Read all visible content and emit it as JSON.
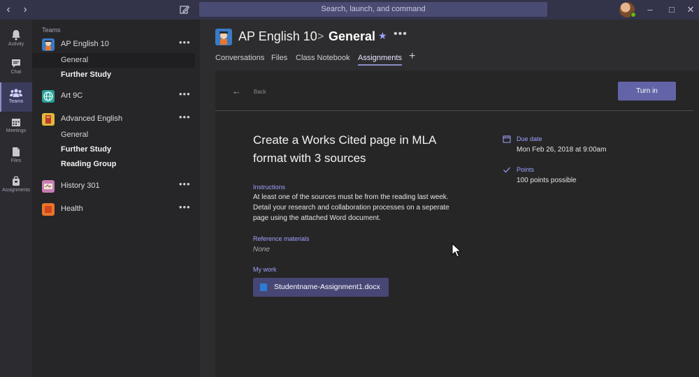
{
  "titlebar": {
    "search_placeholder": "Search, launch, and command"
  },
  "rail": {
    "items": [
      {
        "label": "Activity",
        "icon": "bell-icon"
      },
      {
        "label": "Chat",
        "icon": "chat-icon"
      },
      {
        "label": "Teams",
        "icon": "teams-icon"
      },
      {
        "label": "Meetings",
        "icon": "calendar-icon"
      },
      {
        "label": "Files",
        "icon": "file-icon"
      },
      {
        "label": "Assignments",
        "icon": "bag-icon"
      }
    ]
  },
  "teams": {
    "header": "Teams",
    "list": [
      {
        "name": "AP English 10",
        "color": "#3a7ac6",
        "channels": [
          "General",
          "Further Study"
        ]
      },
      {
        "name": "Art 9C",
        "color": "#2aa198",
        "channels": []
      },
      {
        "name": "Advanced English",
        "color": "#e0b93a",
        "channels": [
          "General",
          "Further Study",
          "Reading Group"
        ]
      },
      {
        "name": "History 301",
        "color": "#c77db5",
        "channels": []
      },
      {
        "name": "Health",
        "color": "#e8762b",
        "channels": []
      }
    ]
  },
  "header": {
    "team": "AP English 10",
    "separator": ">",
    "channel": "General"
  },
  "tabs": [
    "Conversations",
    "Files",
    "Class Notebook",
    "Assignments"
  ],
  "assignment": {
    "back": "Back",
    "turn_in": "Turn in",
    "title": "Create a Works Cited page in MLA format with 3 sources",
    "instructions_label": "Instructions",
    "instructions": "At least one of the sources must be from the reading last week. Detail your research and collaboration processes on a seperate page using the attached Word document.",
    "reference_label": "Reference materials",
    "reference_value": "None",
    "my_work_label": "My work",
    "file_name": "Studentname-Assignment1.docx",
    "due_label": "Due date",
    "due_value": "Mon Feb 26, 2018 at 9:00am",
    "points_label": "Points",
    "points_value": "100 points possible"
  },
  "colors": {
    "accent": "#6264a7",
    "titlebar": "#33344a"
  }
}
